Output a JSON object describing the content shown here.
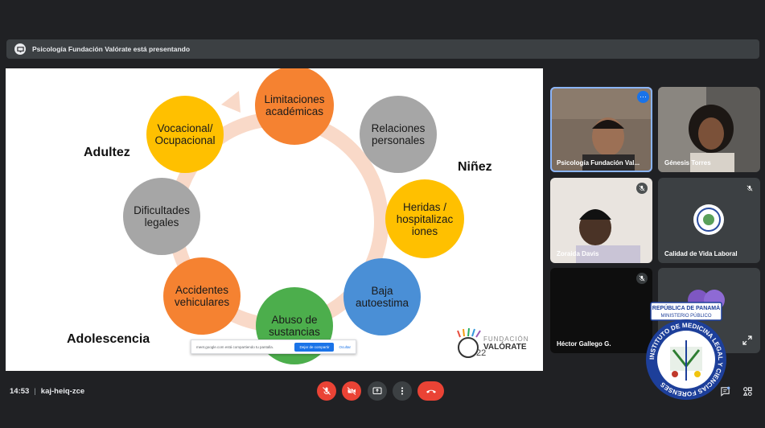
{
  "presenting_bar": {
    "text": "Psicología Fundación Valórate está presentando"
  },
  "slide": {
    "stage_labels": {
      "adultez": "Adultez",
      "ninez": "Niñez",
      "adolescencia": "Adolescencia"
    },
    "circles": [
      {
        "label": "Limitaciones académicas",
        "color": "#f58231"
      },
      {
        "label": "Relaciones personales",
        "color": "#a6a6a6"
      },
      {
        "label": "Heridas / hospitalizac iones",
        "color": "#ffc000"
      },
      {
        "label": "Baja autoestima",
        "color": "#4a8fd6"
      },
      {
        "label": "Abuso de sustancias",
        "color": "#4cae4c"
      },
      {
        "label": "Accidentes vehiculares",
        "color": "#f58231"
      },
      {
        "label": "Dificultades legales",
        "color": "#a6a6a6"
      },
      {
        "label": "Vocacional/ Ocupacional",
        "color": "#ffc000"
      }
    ],
    "share_toast": {
      "text": "meet.google.com está compartiendo tu pantalla.",
      "stop_label": "Dejar de compartir",
      "hide_label": "Ocultar"
    },
    "logo": {
      "line1": "FUNDACIÓN",
      "line2": "VALÓRATE",
      "year": "22"
    }
  },
  "participants": [
    {
      "name": "Psicología Fundación Val...",
      "more_icon": "more-vert-icon"
    },
    {
      "name": "Génesis Torres"
    },
    {
      "name": "Zoraida Davis",
      "muted": true
    },
    {
      "name": "Calidad de Vida Laboral",
      "muted": true
    },
    {
      "name": "Héctor Gallego G.",
      "muted": true
    }
  ],
  "overlay_logo": {
    "top_text": "REPÚBLICA DE PANAMÁ",
    "sub_text": "MINISTERIO PÚBLICO",
    "ring_text": "INSTITUTO DE MEDICINA LEGAL Y CIENCIAS FORENSES"
  },
  "bottom_bar": {
    "time": "14:53",
    "separator": "|",
    "meeting_code": "kaj-heiq-zce"
  },
  "colors": {
    "background": "#202124",
    "danger": "#ea4335",
    "accent": "#1a73e8"
  }
}
